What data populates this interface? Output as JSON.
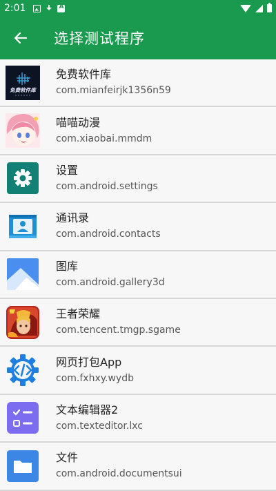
{
  "status_bar": {
    "time": "2:01"
  },
  "toolbar": {
    "title": "选择测试程序"
  },
  "apps": [
    {
      "name": "免费软件库",
      "package": "com.mianfeirjk1356n59",
      "icon": "software-library-icon",
      "icon_text": "免费软件库"
    },
    {
      "name": "喵喵动漫",
      "package": "com.xiaobai.mmdm",
      "icon": "anime-girl-icon"
    },
    {
      "name": "设置",
      "package": "com.android.settings",
      "icon": "gear-icon"
    },
    {
      "name": "通讯录",
      "package": "com.android.contacts",
      "icon": "contacts-icon"
    },
    {
      "name": "图库",
      "package": "com.android.gallery3d",
      "icon": "gallery-icon"
    },
    {
      "name": "王者荣耀",
      "package": "com.tencent.tmgp.sgame",
      "icon": "game-hero-icon"
    },
    {
      "name": "网页打包App",
      "package": "com.fxhxy.wydb",
      "icon": "code-gear-icon"
    },
    {
      "name": "文本编辑器2",
      "package": "com.texteditor.lxc",
      "icon": "checklist-icon"
    },
    {
      "name": "文件",
      "package": "com.android.documentsui",
      "icon": "folder-icon"
    }
  ],
  "colors": {
    "primary": "#1a9a4e",
    "background": "#f7f7f7",
    "divider": "#d6d6d6"
  }
}
